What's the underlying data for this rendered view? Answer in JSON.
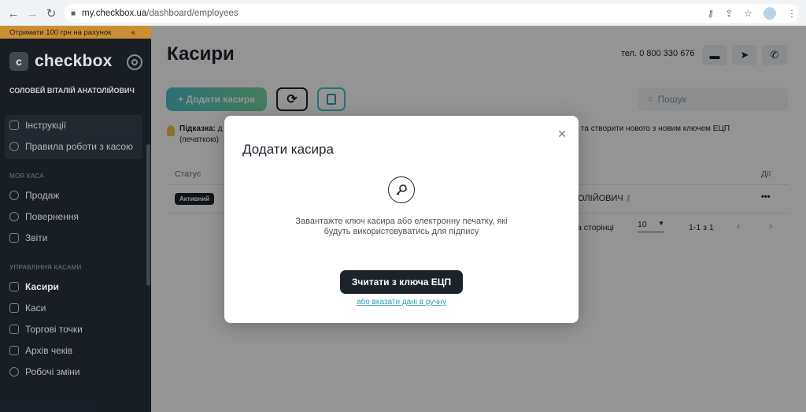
{
  "browser": {
    "url_host": "my.checkbox.ua",
    "url_path": "/dashboard/employees"
  },
  "sidebar": {
    "promo_text": "Отримати 100 грн на рахунок",
    "promo_chevron": "«",
    "logo_letter": "c",
    "logo_text": "checkbox",
    "user_name": "СОЛОВЕЙ ВІТАЛІЙ АНАТОЛІЙОВИЧ",
    "help_items": [
      {
        "label": "Інструкції",
        "icon": "document-icon"
      },
      {
        "label": "Правила роботи з касою",
        "icon": "question-icon"
      }
    ],
    "section_my_kasa": "МОЯ КАСА",
    "my_kasa_items": [
      {
        "label": "Продаж",
        "icon": "arrow-right-circle-icon"
      },
      {
        "label": "Повернення",
        "icon": "arrow-left-circle-icon"
      },
      {
        "label": "Звіти",
        "icon": "report-icon"
      }
    ],
    "section_manage": "УПРАВЛІННЯ КАСАМИ",
    "manage_items": [
      {
        "label": "Касири",
        "icon": "users-icon",
        "active": true
      },
      {
        "label": "Каси",
        "icon": "cash-register-icon",
        "active": false
      },
      {
        "label": "Торгові точки",
        "icon": "store-icon",
        "active": false
      },
      {
        "label": "Архів чеків",
        "icon": "archive-icon",
        "active": false
      },
      {
        "label": "Робочі зміни",
        "icon": "shift-icon",
        "active": false
      }
    ]
  },
  "main": {
    "title": "Касири",
    "phone": "тел. 0 800 330 676",
    "add_button": "+ Додати касира",
    "search_placeholder": "Пошук",
    "hint_label": "Підказка:",
    "hint_text_left": "д",
    "hint_text_left2": "(печаткою)",
    "hint_text_right": "ра та створити нового з новим ключем ЕЦП",
    "table": {
      "col_status": "Статус",
      "col_actions": "Дії",
      "row_status": "Активний",
      "row_name_fragment": "ОЛІЙОВИЧ",
      "row_actions": "•••"
    },
    "pager": {
      "per_page_label": "а сторінці",
      "per_page_value": "10",
      "range": "1-1 з 1"
    }
  },
  "modal": {
    "title": "Додати касира",
    "close": "×",
    "description": "Завантажте ключ касира або електронну печатку, які будуть використовуватись для підпису",
    "primary_button": "Зчитати з ключа ЕЦП",
    "manual_link": "або вказати дані в ручну"
  },
  "colors": {
    "sidebar_bg": "#1d232b",
    "promo": "#e6a33a",
    "accent_gradient_start": "#4ec0c8",
    "accent_gradient_end": "#79d7a2",
    "link": "#2a9fb3"
  }
}
